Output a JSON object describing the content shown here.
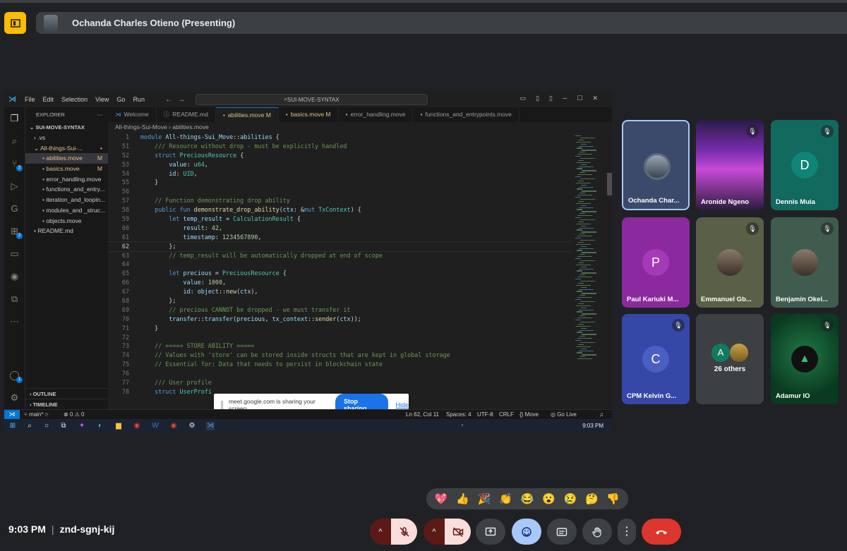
{
  "meet": {
    "presenter_label": "Ochanda Charles Otieno (Presenting)",
    "time": "9:03 PM",
    "separator": "|",
    "meeting_code": "znd-sgnj-kij",
    "share_banner": {
      "text": "meet.google.com is sharing your screen.",
      "stop": "Stop sharing",
      "hide": "Hide"
    },
    "reactions": [
      "💖",
      "👍",
      "🎉",
      "👏",
      "😂",
      "😮",
      "😢",
      "🤔",
      "👎"
    ],
    "participants": [
      {
        "name": "Ochanda Char...",
        "letter": "",
        "bg": "#3b4a6a",
        "muted": false,
        "type": "photo-self"
      },
      {
        "name": "Aronide Ngeno",
        "letter": "",
        "bg": "#4a2c6e",
        "muted": true,
        "type": "video"
      },
      {
        "name": "Dennis Muia",
        "letter": "D",
        "bg": "#12695e",
        "accent": "#0e8576",
        "muted": true,
        "type": "letter"
      },
      {
        "name": "Paul Kariuki M...",
        "letter": "P",
        "bg": "#8b2a9e",
        "accent": "#a43ab8",
        "muted": false,
        "type": "letter"
      },
      {
        "name": "Emmanuel Gb...",
        "letter": "",
        "bg": "#5a5f48",
        "muted": true,
        "type": "photo"
      },
      {
        "name": "Benjamin Okel...",
        "letter": "",
        "bg": "#3f5c4f",
        "muted": true,
        "type": "photo"
      },
      {
        "name": "CPM Kelvin G...",
        "letter": "C",
        "bg": "#3548a8",
        "accent": "#4a5fc4",
        "muted": true,
        "type": "letter"
      },
      {
        "name": "26 others",
        "letter": "A",
        "bg": "#3c4043",
        "accent": "#137a5d",
        "muted": false,
        "type": "others"
      },
      {
        "name": "Adamur IO",
        "letter": "",
        "bg": "#0d4a2a",
        "muted": true,
        "type": "logo"
      }
    ]
  },
  "vscode": {
    "menu": [
      "File",
      "Edit",
      "Selection",
      "View",
      "Go",
      "Run"
    ],
    "search": "SUI-MOVE-SYNTAX",
    "explorer_title": "EXPLORER",
    "root_folder": "SUI-MOVE-SYNTAX",
    "tree": [
      {
        "label": ".vs",
        "indent": 12,
        "mod": false,
        "active": false,
        "badge": ""
      },
      {
        "label": "All-things-Sui-...",
        "indent": 12,
        "mod": true,
        "active": false,
        "badge": "•"
      },
      {
        "label": "abilities.move",
        "indent": 24,
        "mod": true,
        "active": true,
        "badge": "M"
      },
      {
        "label": "basics.move",
        "indent": 24,
        "mod": true,
        "active": false,
        "badge": "M"
      },
      {
        "label": "error_handling.move",
        "indent": 24,
        "mod": false,
        "active": false,
        "badge": ""
      },
      {
        "label": "functions_and_entry...",
        "indent": 24,
        "mod": false,
        "active": false,
        "badge": ""
      },
      {
        "label": "iteration_and_loopin...",
        "indent": 24,
        "mod": false,
        "active": false,
        "badge": ""
      },
      {
        "label": "modules_and _struc...",
        "indent": 24,
        "mod": false,
        "active": false,
        "badge": ""
      },
      {
        "label": "objects.move",
        "indent": 24,
        "mod": false,
        "active": false,
        "badge": ""
      },
      {
        "label": "README.md",
        "indent": 12,
        "mod": false,
        "active": false,
        "badge": ""
      }
    ],
    "outline": "OUTLINE",
    "timeline": "TIMELINE",
    "tabs": [
      {
        "label": "Welcome",
        "active": false,
        "mod": false
      },
      {
        "label": "README.md",
        "active": false,
        "mod": false
      },
      {
        "label": "abilities.move M",
        "active": true,
        "mod": true
      },
      {
        "label": "basics.move M",
        "active": false,
        "mod": true
      },
      {
        "label": "error_handling.move",
        "active": false,
        "mod": false
      },
      {
        "label": "functions_and_entrypoints.move",
        "active": false,
        "mod": false
      }
    ],
    "breadcrumb": "All-things-Sui-Move  ›  abilities.move",
    "code": [
      {
        "n": "1",
        "t": "module All-things-Sui_Move::abilities {"
      },
      {
        "n": "51",
        "t": "    /// Resource without drop - must be explicitly handled"
      },
      {
        "n": "52",
        "t": "    struct PreciousResource {"
      },
      {
        "n": "53",
        "t": "        value: u64,"
      },
      {
        "n": "54",
        "t": "        id: UID,"
      },
      {
        "n": "55",
        "t": "    }"
      },
      {
        "n": "56",
        "t": ""
      },
      {
        "n": "57",
        "t": "    // Function demonstrating drop ability"
      },
      {
        "n": "58",
        "t": "    public fun demonstrate_drop_ability(ctx: &mut TxContext) {"
      },
      {
        "n": "59",
        "t": "        let temp_result = CalculationResult {"
      },
      {
        "n": "60",
        "t": "            result: 42,"
      },
      {
        "n": "61",
        "t": "            timestamp: 1234567890,"
      },
      {
        "n": "62",
        "t": "        };"
      },
      {
        "n": "63",
        "t": "        // temp_result will be automatically dropped at end of scope"
      },
      {
        "n": "64",
        "t": ""
      },
      {
        "n": "65",
        "t": "        let precious = PreciousResource {"
      },
      {
        "n": "66",
        "t": "            value: 1000,"
      },
      {
        "n": "67",
        "t": "            id: object::new(ctx),"
      },
      {
        "n": "68",
        "t": "        };"
      },
      {
        "n": "69",
        "t": "        // precious CANNOT be dropped - we must transfer it"
      },
      {
        "n": "70",
        "t": "        transfer::transfer(precious, tx_context::sender(ctx));"
      },
      {
        "n": "71",
        "t": "    }"
      },
      {
        "n": "72",
        "t": ""
      },
      {
        "n": "73",
        "t": "    // ===== STORE ABILITY ====="
      },
      {
        "n": "74",
        "t": "    // Values with 'store' can be stored inside structs that are kept in global storage"
      },
      {
        "n": "75",
        "t": "    // Essential for: Data that needs to persist in blockchain state"
      },
      {
        "n": "76",
        "t": ""
      },
      {
        "n": "77",
        "t": "    /// User profile"
      },
      {
        "n": "78",
        "t": "    struct UserProfi"
      }
    ],
    "status": {
      "branch": "main*",
      "problems": "⊗ 0 ⚠ 0",
      "position": "Ln 62, Col 11",
      "spaces": "Spaces: 4",
      "encoding": "UTF-8",
      "eol": "CRLF",
      "language": "{} Move",
      "golive": "Go Live"
    },
    "taskbar_time": "9:03 PM"
  }
}
